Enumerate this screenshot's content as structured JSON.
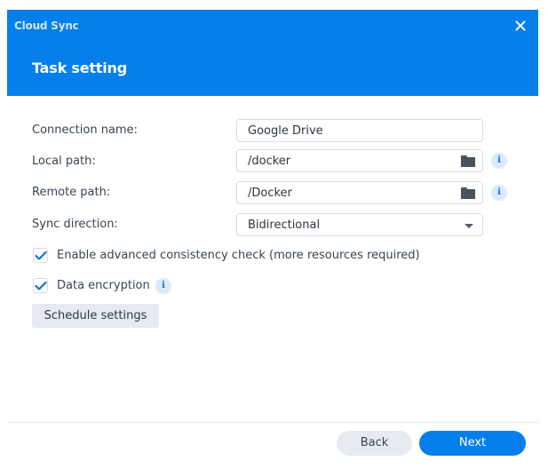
{
  "window": {
    "app_title": "Cloud Sync",
    "page_title": "Task setting",
    "close_icon": "close-icon"
  },
  "colors": {
    "accent": "#057feb",
    "secondary_button": "#e6ebf2",
    "info_badge": "#dcebfa"
  },
  "form": {
    "connection_name": {
      "label": "Connection name:",
      "value": "Google Drive"
    },
    "local_path": {
      "label": "Local path:",
      "value": "/docker",
      "icon": "folder-icon",
      "info_icon": "info-icon"
    },
    "remote_path": {
      "label": "Remote path:",
      "value": "/Docker",
      "icon": "folder-icon",
      "info_icon": "info-icon"
    },
    "sync_direction": {
      "label": "Sync direction:",
      "value": "Bidirectional",
      "icon": "chevron-down-icon"
    },
    "advanced_check": {
      "label": "Enable advanced consistency check (more resources required)",
      "checked": true
    },
    "data_encryption": {
      "label": "Data encryption",
      "checked": true,
      "info_icon": "info-icon"
    },
    "schedule_button": "Schedule settings"
  },
  "footer": {
    "back_label": "Back",
    "next_label": "Next"
  },
  "info_glyph": "i"
}
